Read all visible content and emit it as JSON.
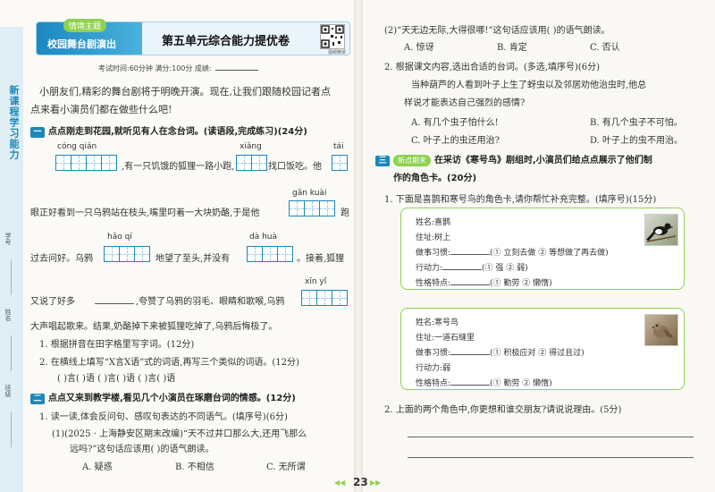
{
  "left": {
    "side_title": "新课程学习能力",
    "side_labels": [
      "学号",
      "姓名",
      "班级"
    ],
    "header": {
      "tag": "情境主题",
      "theme": "校园舞台剧演出",
      "title": "第五单元综合能力提优卷",
      "qr_caption": "视频精讲",
      "exam_info": "考试时间:60分钟   满分:100分   成绩:"
    },
    "intro_1": "小朋友们,精彩的舞台剧将于明晚开演。现在,让我们跟随校园记者点",
    "intro_2": "点来看小演员们都在做些什么吧!",
    "sec1": {
      "num": "一",
      "title": "点点刚走到花园,就听见有人在念台词。(读语段,完成练习)(24分)"
    },
    "pinyin": [
      "cóng qián",
      "xiǎng",
      "tái",
      "gǎn kuài",
      "hǎo qí",
      "dà huà",
      "xīn yǐ"
    ],
    "passage": [
      ",有一只饥饿的狐狸一路小跑,",
      "找口饭吃。他",
      "眼正好看到一只乌鸦站在枝头,嘴里叼着一大块奶酪,于是他",
      "跑",
      "过去问好。乌鸦",
      "地望了至头,并没有",
      "。接着,狐狸",
      "又说了好多",
      ",夸赞了乌鸦的羽毛、眼睛和歌喉,乌鸦",
      "大声唱起歌来。结果,奶酪掉下来被狐狸吃掉了,乌鸦后悔极了。"
    ],
    "q1": "1. 根据拼音在田字格里写字词。(12分)",
    "q2": "2. 在横线上填写“X言X语”式的词语,再写三个类似的词语。(12分)",
    "q2_blanks": "(    )言(    )语   (    )言(    )语   (    )言(    )语",
    "sec2": {
      "num": "二",
      "title": "点点又来到教学楼,看见几个小演员在琢磨台词的情感。(12分)"
    },
    "s2q1": "1. 读一读,体会反问句、感叹句表达的不同语气。(填序号)(6分)",
    "s2q1_1a": "(1)(2025 · 上海静安区期末改编)“天不过井口那么大,还用飞那么",
    "s2q1_1b": "远吗?”这句话应该用(    )的语气朗读。",
    "s2q1_1_opts": [
      "A. 疑惑",
      "B. 不相信",
      "C. 无所谓"
    ]
  },
  "right": {
    "q1_2": "(2)“天无边无际,大得很哪!”这句话应该用(    )的语气朗读。",
    "q1_2_opts": [
      "A. 惊讶",
      "B. 肯定",
      "C. 否认"
    ],
    "q2": "2. 根据课文内容,选出合适的台词。(多选,填序号)(6分)",
    "q2_desc_1": "当种葫芦的人看到叶子上生了蚜虫以及邻居劝他治虫时,他总",
    "q2_desc_2": "样说才能表达自己强烈的感情?",
    "q2_opts": [
      "A. 有几个虫子怕什么!",
      "B. 有几个虫子不可怕。",
      "C. 叶子上的虫还用治?",
      "D. 叶子上的虫不用治。"
    ],
    "sec3": {
      "num": "三",
      "tag": "新点期末",
      "title": "在采访《寒号鸟》剧组时,小演员们给点点展示了他们制",
      "title_2": "作的角色卡。(20分)"
    },
    "s3q1": "1. 下面是喜鹊和寒号鸟的角色卡,请你帮忙补充完整。(填序号)(15分)",
    "card1": {
      "name": "姓名:喜鹊",
      "home": "住址:树上",
      "habit": "做事习惯:",
      "habit_opts": "(① 立刻去做  ② 等想做了再去做)",
      "action": "行动力:",
      "action_opts": "(① 强  ② 弱)",
      "trait": "性格特点:",
      "trait_opts": "(① 勤劳  ② 懒惰)"
    },
    "card2": {
      "name": "姓名:寒号鸟",
      "home": "住址:一道石缝里",
      "habit": "做事习惯:",
      "habit_opts": "(① 积极应对  ② 得过且过)",
      "action": "行动力:弱",
      "trait": "性格特点:",
      "trait_opts": "(① 勤劳  ② 懒惰)"
    },
    "s3q2": "2. 上面的两个角色中,你更想和谁交朋友?请说说理由。(5分)"
  },
  "page_number": "23",
  "colors": {
    "accent": "#1c87b8",
    "green": "#8fd14f"
  }
}
